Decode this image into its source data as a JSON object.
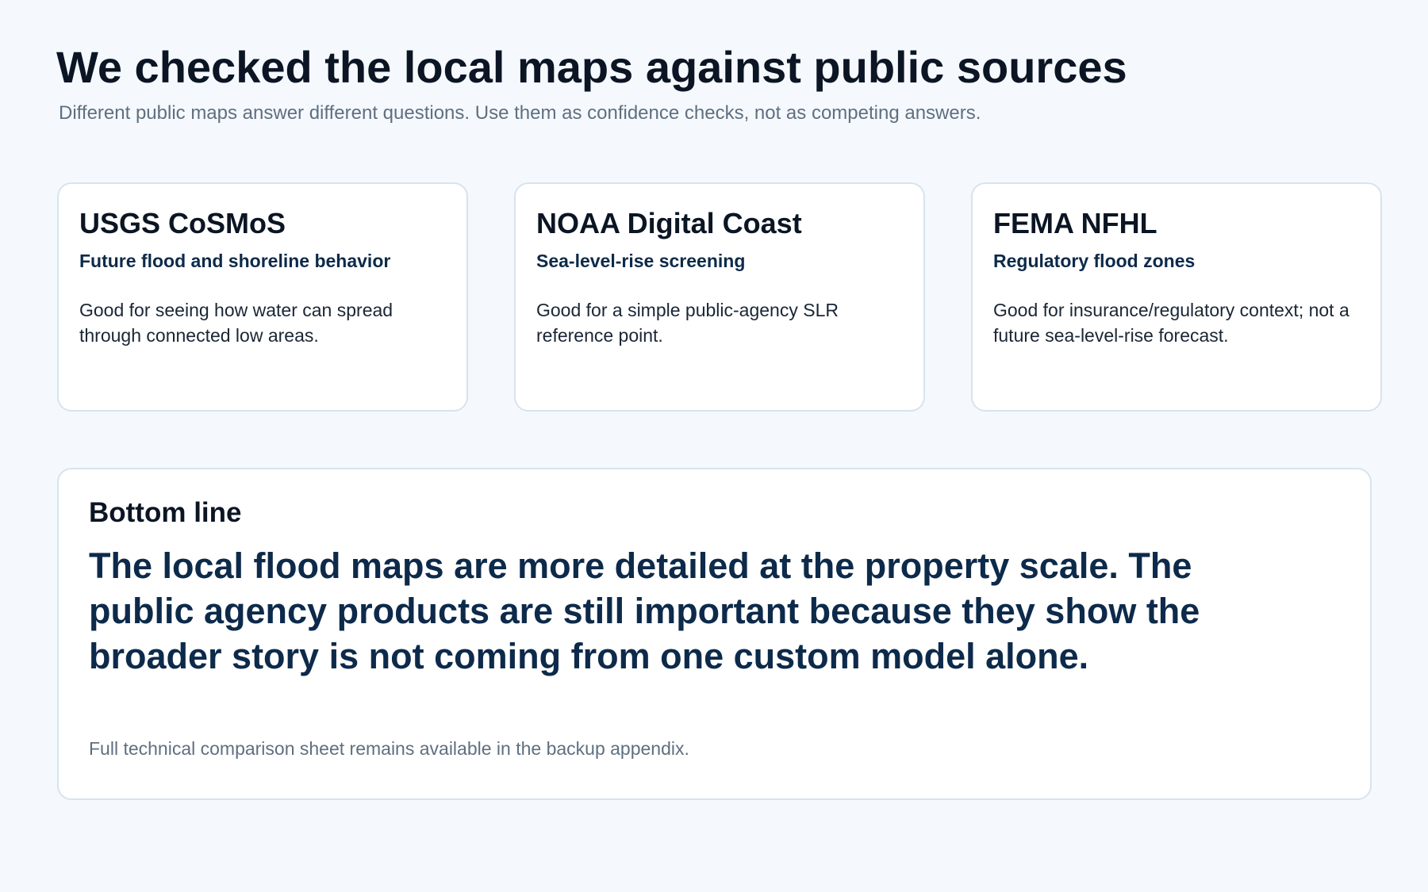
{
  "header": {
    "title": "We checked the local maps against public sources",
    "subtitle": "Different public maps answer different questions. Use them as confidence checks, not as competing answers."
  },
  "sources": [
    {
      "name": "USGS CoSMoS",
      "focus": "Future flood and shoreline behavior",
      "description": "Good for seeing how water can spread through connected low areas."
    },
    {
      "name": "NOAA Digital Coast",
      "focus": "Sea-level-rise screening",
      "description": "Good for a simple public-agency SLR reference point."
    },
    {
      "name": "FEMA NFHL",
      "focus": "Regulatory flood zones",
      "description": "Good for insurance/regulatory context; not a future sea-level-rise forecast."
    }
  ],
  "bottom_line": {
    "label": "Bottom line",
    "statement": "The local flood maps are more detailed at the property scale. The public agency products are still important because they show the broader story is not coming from one custom model alone.",
    "note": "Full technical comparison sheet remains available in the backup appendix."
  },
  "colors": {
    "background": "#f5f9fd",
    "heading": "#0b1524",
    "accent_navy": "#0d2a4a",
    "muted_text": "#5f6f80",
    "card_border": "#d8e3ee"
  }
}
